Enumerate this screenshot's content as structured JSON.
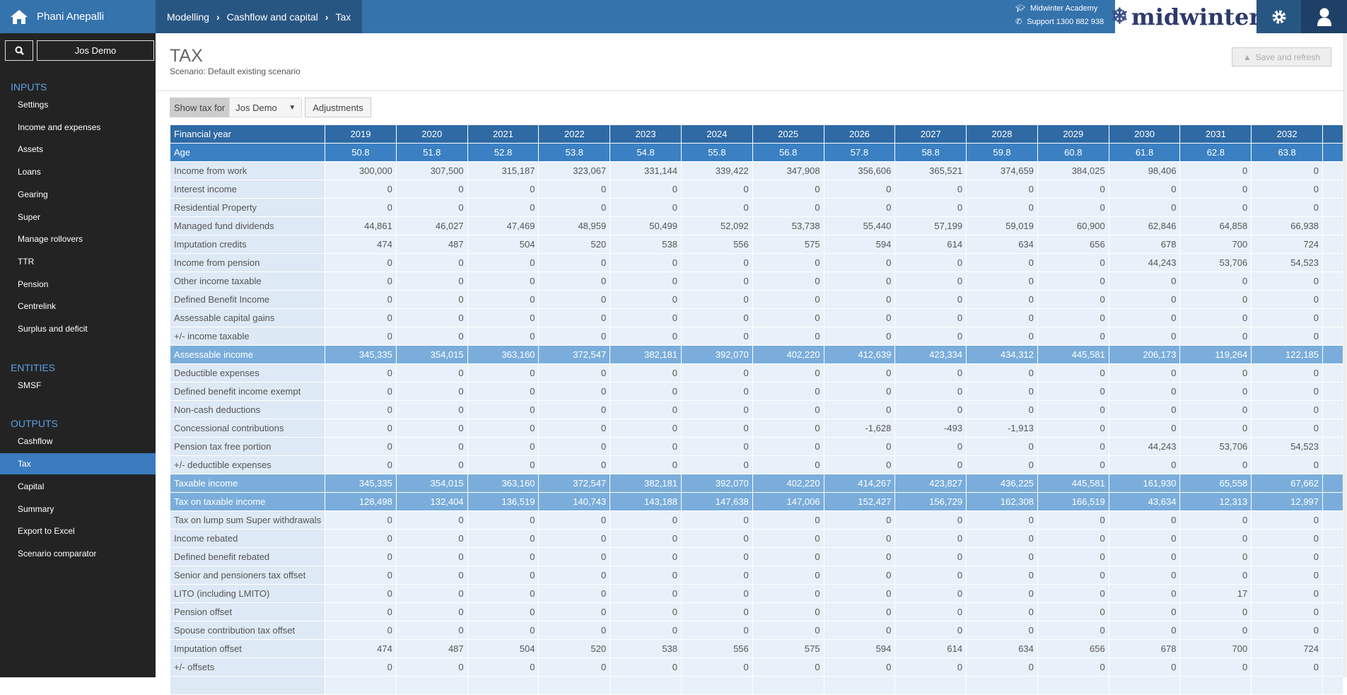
{
  "header": {
    "user_name": "Phani Anepalli",
    "breadcrumb": [
      "Modelling",
      "Cashflow and capital",
      "Tax"
    ],
    "academy": "Midwinter Academy",
    "support": "Support 1300 882 938",
    "logo_text": "midwinter",
    "icons": [
      "home-icon",
      "graduation-cap-icon",
      "phone-icon",
      "snowflake-icon",
      "gear-icon",
      "user-icon"
    ]
  },
  "sidebar": {
    "client": "Jos Demo",
    "sections": [
      {
        "title": "INPUTS",
        "items": [
          "Settings",
          "Income and expenses",
          "Assets",
          "Loans",
          "Gearing",
          "Super",
          "Manage rollovers",
          "TTR",
          "Pension",
          "Centrelink",
          "Surplus and deficit"
        ]
      },
      {
        "title": "ENTITIES",
        "items": [
          "SMSF"
        ]
      },
      {
        "title": "OUTPUTS",
        "items": [
          "Cashflow",
          "Tax",
          "Capital",
          "Summary",
          "Export to Excel",
          "Scenario comparator"
        ]
      }
    ],
    "active": "Tax"
  },
  "page": {
    "title": "TAX",
    "scenario": "Scenario: Default existing scenario",
    "save_label": "Save and refresh",
    "show_tax_for": "Show tax for",
    "selected_person": "Jos Demo",
    "adjustments": "Adjustments"
  },
  "colors": {
    "accent": "#3573ad",
    "header_dark": "#285683",
    "highlight_row": "#7aaddb",
    "sidebar": "#232323"
  },
  "table": {
    "header_label": "Financial year",
    "years": [
      "2019",
      "2020",
      "2021",
      "2022",
      "2023",
      "2024",
      "2025",
      "2026",
      "2027",
      "2028",
      "2029",
      "2030",
      "2031",
      "2032"
    ],
    "age_label": "Age",
    "ages": [
      "50.8",
      "51.8",
      "52.8",
      "53.8",
      "54.8",
      "55.8",
      "56.8",
      "57.8",
      "58.8",
      "59.8",
      "60.8",
      "61.8",
      "62.8",
      "63.8"
    ],
    "rows": [
      {
        "label": "Income from work",
        "values": [
          "300,000",
          "307,500",
          "315,187",
          "323,067",
          "331,144",
          "339,422",
          "347,908",
          "356,606",
          "365,521",
          "374,659",
          "384,025",
          "98,406",
          "0",
          "0"
        ]
      },
      {
        "label": "Interest income",
        "values": [
          "0",
          "0",
          "0",
          "0",
          "0",
          "0",
          "0",
          "0",
          "0",
          "0",
          "0",
          "0",
          "0",
          "0"
        ]
      },
      {
        "label": "Residential Property",
        "values": [
          "0",
          "0",
          "0",
          "0",
          "0",
          "0",
          "0",
          "0",
          "0",
          "0",
          "0",
          "0",
          "0",
          "0"
        ]
      },
      {
        "label": "Managed fund dividends",
        "values": [
          "44,861",
          "46,027",
          "47,469",
          "48,959",
          "50,499",
          "52,092",
          "53,738",
          "55,440",
          "57,199",
          "59,019",
          "60,900",
          "62,846",
          "64,858",
          "66,938"
        ]
      },
      {
        "label": "Imputation credits",
        "values": [
          "474",
          "487",
          "504",
          "520",
          "538",
          "556",
          "575",
          "594",
          "614",
          "634",
          "656",
          "678",
          "700",
          "724"
        ]
      },
      {
        "label": "Income from pension",
        "values": [
          "0",
          "0",
          "0",
          "0",
          "0",
          "0",
          "0",
          "0",
          "0",
          "0",
          "0",
          "44,243",
          "53,706",
          "54,523"
        ]
      },
      {
        "label": "Other income taxable",
        "values": [
          "0",
          "0",
          "0",
          "0",
          "0",
          "0",
          "0",
          "0",
          "0",
          "0",
          "0",
          "0",
          "0",
          "0"
        ]
      },
      {
        "label": "Defined Benefit Income",
        "values": [
          "0",
          "0",
          "0",
          "0",
          "0",
          "0",
          "0",
          "0",
          "0",
          "0",
          "0",
          "0",
          "0",
          "0"
        ]
      },
      {
        "label": "Assessable capital gains",
        "values": [
          "0",
          "0",
          "0",
          "0",
          "0",
          "0",
          "0",
          "0",
          "0",
          "0",
          "0",
          "0",
          "0",
          "0"
        ]
      },
      {
        "label": "+/- income taxable",
        "values": [
          "0",
          "0",
          "0",
          "0",
          "0",
          "0",
          "0",
          "0",
          "0",
          "0",
          "0",
          "0",
          "0",
          "0"
        ]
      },
      {
        "label": "Assessable income",
        "highlight": true,
        "values": [
          "345,335",
          "354,015",
          "363,160",
          "372,547",
          "382,181",
          "392,070",
          "402,220",
          "412,639",
          "423,334",
          "434,312",
          "445,581",
          "206,173",
          "119,264",
          "122,185"
        ]
      },
      {
        "label": "Deductible expenses",
        "values": [
          "0",
          "0",
          "0",
          "0",
          "0",
          "0",
          "0",
          "0",
          "0",
          "0",
          "0",
          "0",
          "0",
          "0"
        ]
      },
      {
        "label": "Defined benefit income exempt",
        "values": [
          "0",
          "0",
          "0",
          "0",
          "0",
          "0",
          "0",
          "0",
          "0",
          "0",
          "0",
          "0",
          "0",
          "0"
        ]
      },
      {
        "label": "Non-cash deductions",
        "values": [
          "0",
          "0",
          "0",
          "0",
          "0",
          "0",
          "0",
          "0",
          "0",
          "0",
          "0",
          "0",
          "0",
          "0"
        ]
      },
      {
        "label": "Concessional contributions",
        "values": [
          "0",
          "0",
          "0",
          "0",
          "0",
          "0",
          "0",
          "-1,628",
          "-493",
          "-1,913",
          "0",
          "0",
          "0",
          "0"
        ]
      },
      {
        "label": "Pension tax free portion",
        "values": [
          "0",
          "0",
          "0",
          "0",
          "0",
          "0",
          "0",
          "0",
          "0",
          "0",
          "0",
          "44,243",
          "53,706",
          "54,523"
        ]
      },
      {
        "label": "+/- deductible expenses",
        "values": [
          "0",
          "0",
          "0",
          "0",
          "0",
          "0",
          "0",
          "0",
          "0",
          "0",
          "0",
          "0",
          "0",
          "0"
        ]
      },
      {
        "label": "Taxable income",
        "highlight": true,
        "values": [
          "345,335",
          "354,015",
          "363,160",
          "372,547",
          "382,181",
          "392,070",
          "402,220",
          "414,267",
          "423,827",
          "436,225",
          "445,581",
          "161,930",
          "65,558",
          "67,662"
        ]
      },
      {
        "label": "Tax on taxable income",
        "highlight": true,
        "values": [
          "128,498",
          "132,404",
          "136,519",
          "140,743",
          "143,188",
          "147,638",
          "147,006",
          "152,427",
          "156,729",
          "162,308",
          "166,519",
          "43,634",
          "12,313",
          "12,997"
        ]
      },
      {
        "label": "Tax on lump sum Super withdrawals",
        "values": [
          "0",
          "0",
          "0",
          "0",
          "0",
          "0",
          "0",
          "0",
          "0",
          "0",
          "0",
          "0",
          "0",
          "0"
        ]
      },
      {
        "label": "Income rebated",
        "values": [
          "0",
          "0",
          "0",
          "0",
          "0",
          "0",
          "0",
          "0",
          "0",
          "0",
          "0",
          "0",
          "0",
          "0"
        ]
      },
      {
        "label": "Defined benefit rebated",
        "values": [
          "0",
          "0",
          "0",
          "0",
          "0",
          "0",
          "0",
          "0",
          "0",
          "0",
          "0",
          "0",
          "0",
          "0"
        ]
      },
      {
        "label": "Senior and pensioners tax offset",
        "values": [
          "0",
          "0",
          "0",
          "0",
          "0",
          "0",
          "0",
          "0",
          "0",
          "0",
          "0",
          "0",
          "0",
          "0"
        ]
      },
      {
        "label": "LITO (including LMITO)",
        "values": [
          "0",
          "0",
          "0",
          "0",
          "0",
          "0",
          "0",
          "0",
          "0",
          "0",
          "0",
          "0",
          "17",
          "0"
        ]
      },
      {
        "label": "Pension offset",
        "values": [
          "0",
          "0",
          "0",
          "0",
          "0",
          "0",
          "0",
          "0",
          "0",
          "0",
          "0",
          "0",
          "0",
          "0"
        ]
      },
      {
        "label": "Spouse contribution tax offset",
        "values": [
          "0",
          "0",
          "0",
          "0",
          "0",
          "0",
          "0",
          "0",
          "0",
          "0",
          "0",
          "0",
          "0",
          "0"
        ]
      },
      {
        "label": "Imputation offset",
        "values": [
          "474",
          "487",
          "504",
          "520",
          "538",
          "556",
          "575",
          "594",
          "614",
          "634",
          "656",
          "678",
          "700",
          "724"
        ]
      },
      {
        "label": "+/- offsets",
        "values": [
          "0",
          "0",
          "0",
          "0",
          "0",
          "0",
          "0",
          "0",
          "0",
          "0",
          "0",
          "0",
          "0",
          "0"
        ]
      }
    ]
  }
}
